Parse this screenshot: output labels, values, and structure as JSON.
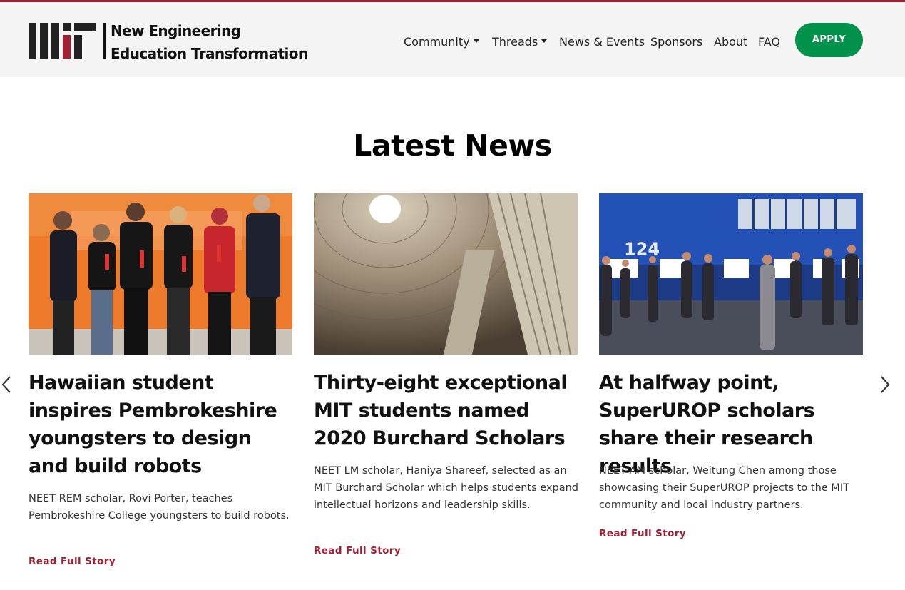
{
  "brand": {
    "logo_mark": "MIT",
    "line1": "New Engineering",
    "line2": "Education Transformation",
    "accent_color": "#a31f34"
  },
  "nav": {
    "items": [
      {
        "label": "Community",
        "dropdown": true
      },
      {
        "label": "Threads",
        "dropdown": true
      },
      {
        "label": "News & Events",
        "dropdown": false
      },
      {
        "label": "Sponsors",
        "dropdown": false
      },
      {
        "label": "About",
        "dropdown": false
      },
      {
        "label": "FAQ",
        "dropdown": false
      }
    ],
    "apply_label": "APPLY",
    "apply_color": "#00914a"
  },
  "section": {
    "title": "Latest News"
  },
  "carousel": {
    "prev_icon": "chevron-left-icon",
    "next_icon": "chevron-right-icon"
  },
  "cards": [
    {
      "image": "group-photo-robots-award",
      "title": "Hawaiian student inspires Pembrokeshire youngsters to design and build robots",
      "summary": "NEET REM scholar, Rovi Porter, teaches Pembrokeshire College youngsters to build robots.",
      "link": "Read Full Story"
    },
    {
      "image": "pantheon-dome-photo",
      "title": "Thirty-eight exceptional MIT students named 2020 Burchard Scholars",
      "summary": "NEET LM scholar, Haniya Shareef, selected as an MIT Burchard Scholar which helps students expand intellectual horizons and leadership skills.",
      "link": "Read Full Story"
    },
    {
      "image": "superurop-showcase-photo",
      "title": "At halfway point, SuperUROP scholars share their research results",
      "summary": "NEET AM scholar, Weitung Chen among those showcasing their SuperUROP projects to the MIT community and local industry partners.",
      "link": "Read Full Story"
    }
  ],
  "room_sign": "124"
}
